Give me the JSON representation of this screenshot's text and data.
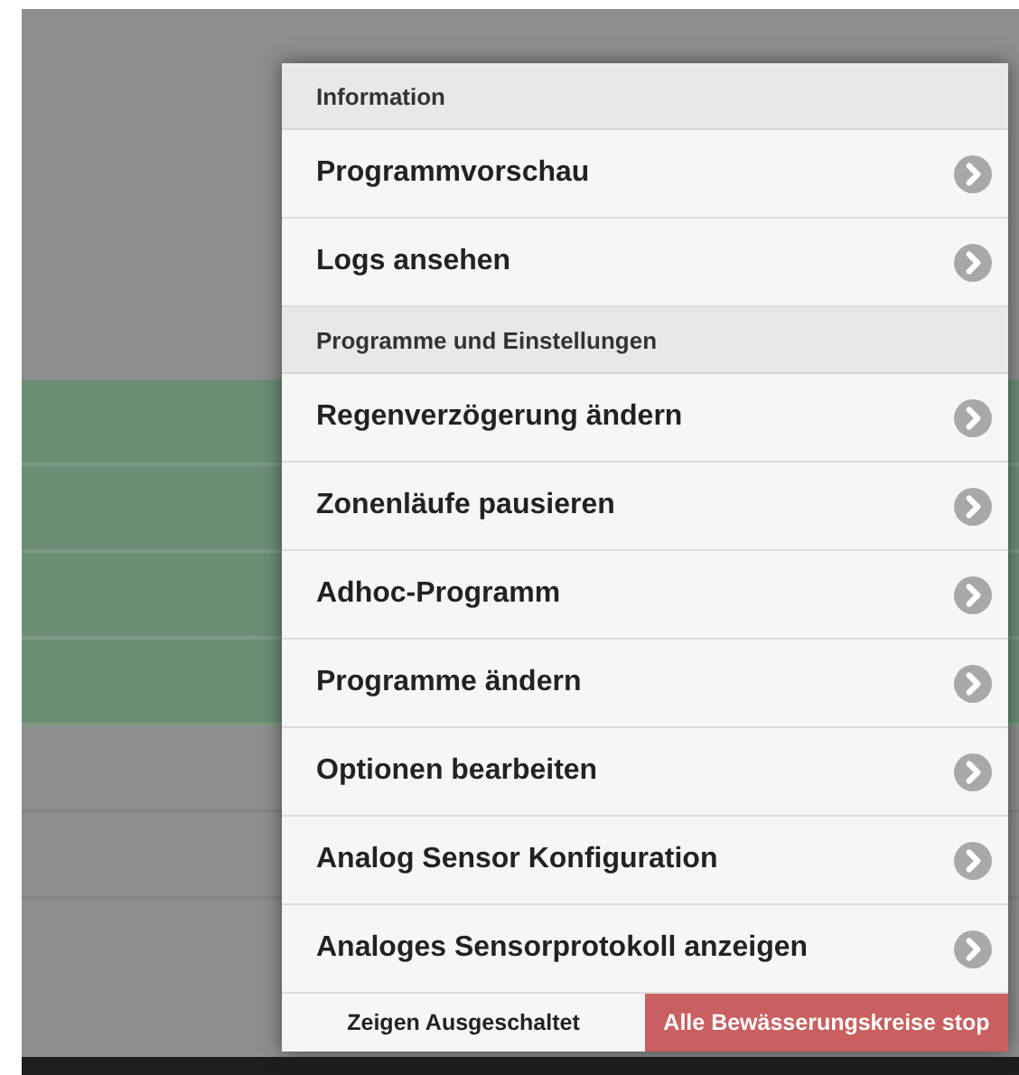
{
  "menu": {
    "sections": [
      {
        "header": "Information",
        "items": [
          {
            "label": "Programmvorschau"
          },
          {
            "label": "Logs ansehen"
          }
        ]
      },
      {
        "header": "Programme und Einstellungen",
        "items": [
          {
            "label": "Regenverzögerung ändern"
          },
          {
            "label": "Zonenläufe pausieren"
          },
          {
            "label": "Adhoc-Programm"
          },
          {
            "label": "Programme ändern"
          },
          {
            "label": "Optionen bearbeiten"
          },
          {
            "label": "Analog Sensor Konfiguration"
          },
          {
            "label": "Analoges Sensorprotokoll anzeigen"
          }
        ]
      }
    ],
    "footer": [
      {
        "label": "Zeigen Ausgeschaltet",
        "kind": "plain"
      },
      {
        "label": "Alle Bewässerungskreise stop",
        "kind": "danger"
      }
    ]
  }
}
